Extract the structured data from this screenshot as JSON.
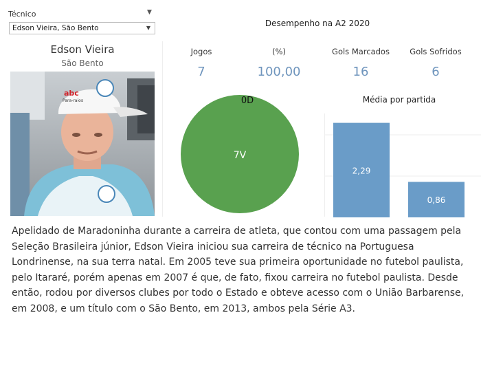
{
  "filter": {
    "label": "Técnico",
    "selected": "Edson Vieira, São Bento"
  },
  "coach": {
    "name": "Edson Vieira",
    "club": "São Bento",
    "cap_text": "abc",
    "cap_subtext": "Para-raios"
  },
  "dashboard": {
    "title": "Desempenho na A2 2020",
    "kpis": {
      "jogos_label": "Jogos",
      "jogos_value": "7",
      "pct_label": "(%)",
      "pct_value": "100,00",
      "gols_marcados_label": "Gols Marcados",
      "gols_marcados_value": "16",
      "gols_sofridos_label": "Gols Sofridos",
      "gols_sofridos_value": "6"
    }
  },
  "colors": {
    "accent_blue": "#6f95bd",
    "pie_green": "#59a14f",
    "bar_blue": "#6a9cc8"
  },
  "chart_data": [
    {
      "type": "pie",
      "labels": [
        "7V",
        "0D"
      ],
      "values": [
        7,
        0
      ],
      "colors": [
        "#59a14f",
        "#e15759"
      ]
    },
    {
      "type": "bar",
      "title": "Média por partida",
      "categories": [
        "Gols Marcados",
        "Gols Sofridos"
      ],
      "values": [
        2.29,
        0.86
      ],
      "value_labels": [
        "2,29",
        "0,86"
      ],
      "ylim": [
        0,
        2.6
      ],
      "grid": true
    }
  ],
  "bio": "Apelidado de Maradoninha durante a carreira de atleta, que contou com uma passagem pela Seleção Brasileira júnior, Edson Vieira iniciou sua carreira de técnico na Portuguesa Londrinense, na sua terra natal. Em 2005 teve sua primeira oportunidade no futebol paulista, pelo Itararé, porém apenas em 2007 é que, de fato, fixou carreira no futebol paulista. Desde então, rodou por diversos clubes por todo o Estado e obteve acesso com o União Barbarense, em 2008, e um título com o São Bento, em 2013, ambos pela Série A3."
}
